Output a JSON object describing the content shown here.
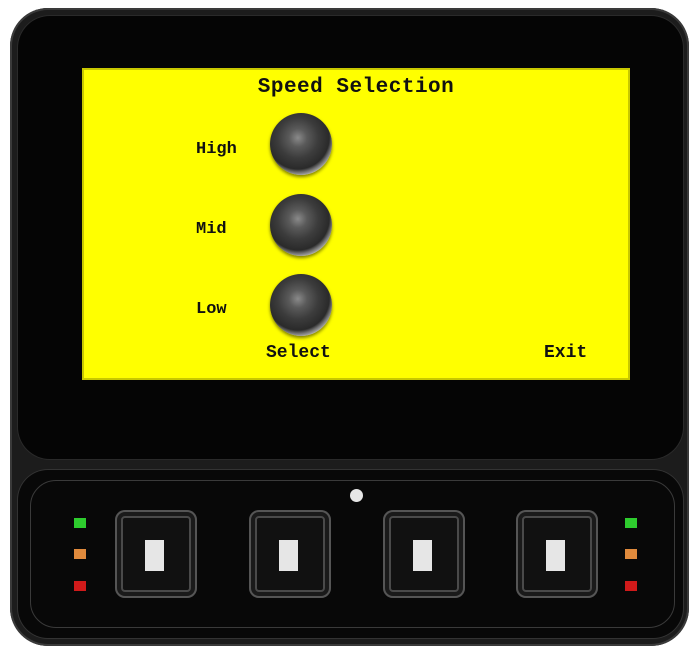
{
  "screen": {
    "title": "Speed Selection",
    "options": [
      {
        "label": "High"
      },
      {
        "label": "Mid"
      },
      {
        "label": "Low"
      }
    ],
    "softkeys": {
      "left": "Select",
      "right": "Exit"
    },
    "background_color": "#ffff00"
  },
  "leds": {
    "left": [
      "green",
      "orange",
      "red"
    ],
    "right": [
      "green",
      "orange",
      "red"
    ]
  },
  "hardware_buttons": [
    "button-1",
    "button-2",
    "button-3",
    "button-4"
  ]
}
